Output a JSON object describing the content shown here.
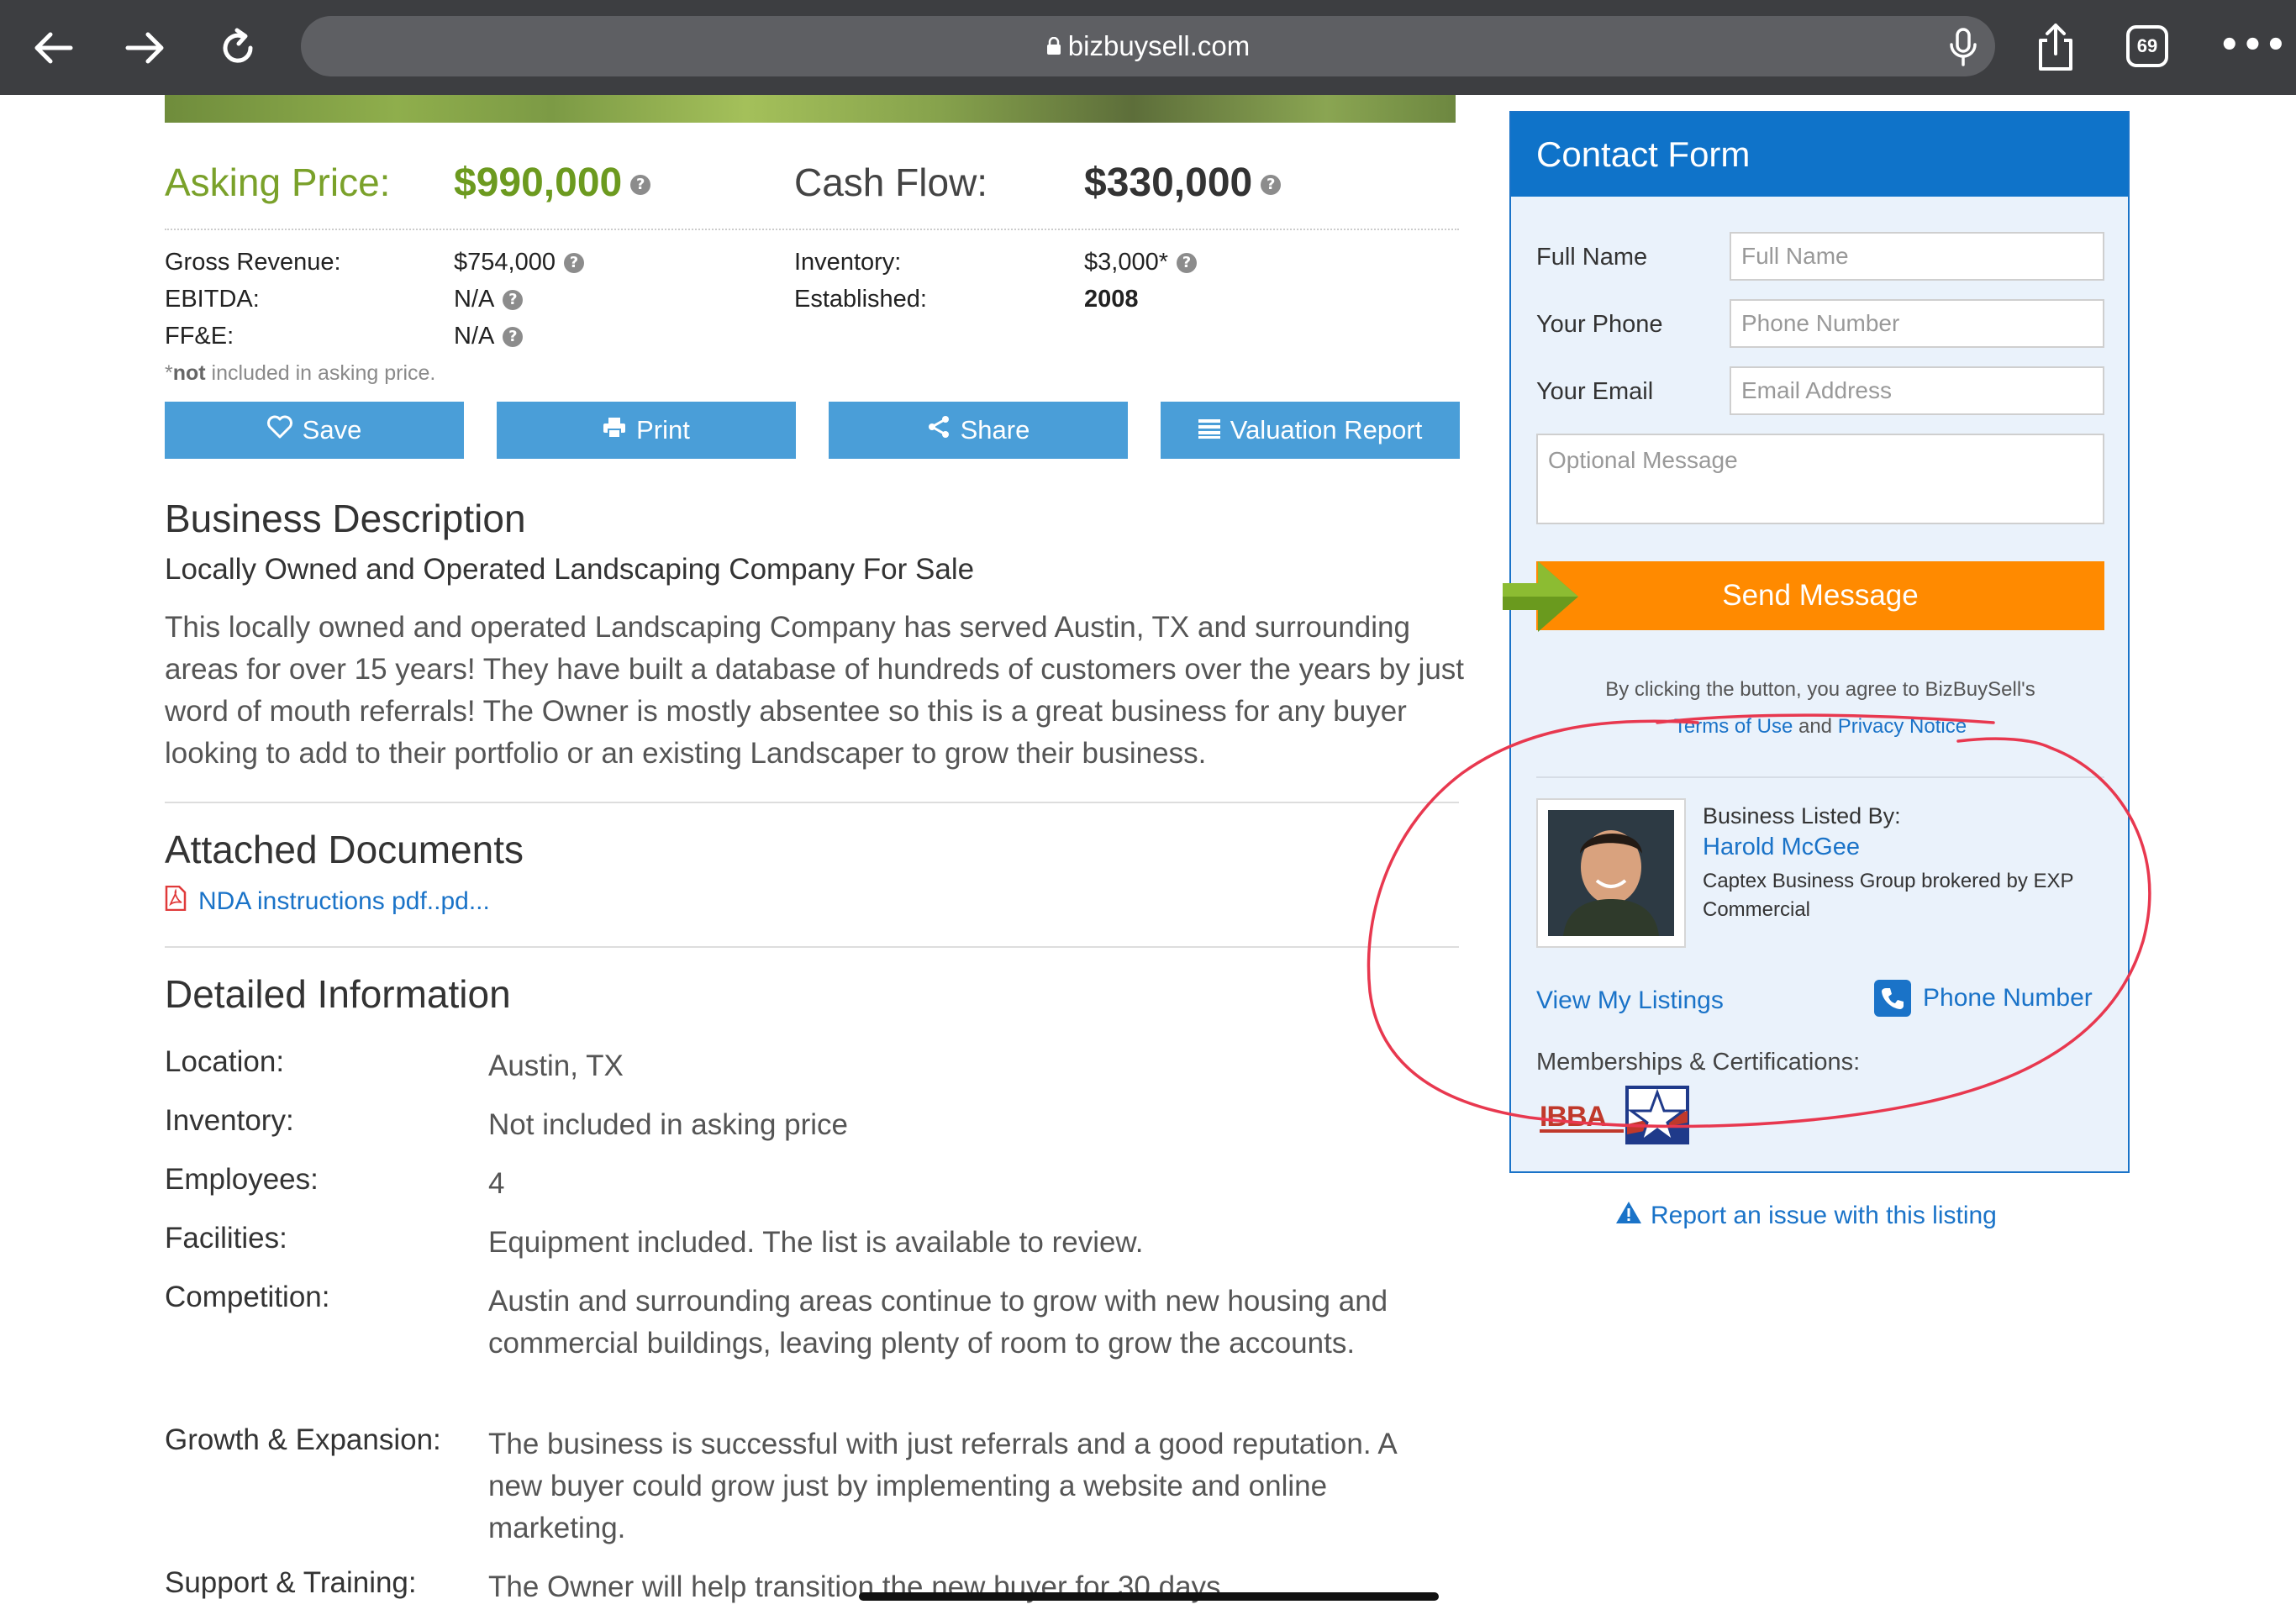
{
  "browser": {
    "url": "bizbuysell.com",
    "tab_count": "69",
    "icons": [
      "back-arrow-icon",
      "forward-arrow-icon",
      "reload-icon",
      "lock-icon",
      "mic-icon",
      "share-icon",
      "tabs-icon",
      "more-icon"
    ]
  },
  "pricing": {
    "asking_label": "Asking Price:",
    "asking_value": "$990,000",
    "cash_label": "Cash Flow:",
    "cash_value": "$330,000"
  },
  "financials": {
    "gross_label": "Gross Revenue:",
    "gross_value": "$754,000",
    "ebitda_label": "EBITDA:",
    "ebitda_value": "N/A",
    "ffe_label": "FF&E:",
    "ffe_value": "N/A",
    "inventory_label": "Inventory:",
    "inventory_value": "$3,000*",
    "established_label": "Established:",
    "established_value": "2008",
    "note_star": "*",
    "note_bold": "not",
    "note_rest": " included in asking price."
  },
  "actions": {
    "save": "Save",
    "print": "Print",
    "share": "Share",
    "valuation": "Valuation Report"
  },
  "description": {
    "heading": "Business Description",
    "subheading": "Locally Owned and Operated Landscaping Company For Sale",
    "body": "This locally owned and operated Landscaping Company has served Austin, TX and surrounding areas for over 15 years! They have built a database of hundreds of customers over the years by just word of mouth referrals! The Owner is mostly absentee so this is a great business for any buyer looking to add to their portfolio or an existing Landscaper to grow their business."
  },
  "documents": {
    "heading": "Attached Documents",
    "file": "NDA instructions pdf..pd..."
  },
  "details": {
    "heading": "Detailed Information",
    "rows": [
      {
        "label": "Location:",
        "value": "Austin, TX"
      },
      {
        "label": "Inventory:",
        "value": "Not included in asking price"
      },
      {
        "label": "Employees:",
        "value": "4"
      },
      {
        "label": "Facilities:",
        "value": "Equipment included. The list is available to review."
      },
      {
        "label": "Competition:",
        "value": "Austin and surrounding areas continue to grow with new housing and commercial buildings, leaving plenty of room to grow the accounts."
      },
      {
        "label": "Growth & Expansion:",
        "value": "The business is successful with just referrals and a good reputation. A new buyer could grow just by implementing a website and online marketing."
      },
      {
        "label": "Support & Training:",
        "value": "The Owner will help transition the new buyer for 30 days."
      }
    ]
  },
  "contact_form": {
    "title": "Contact Form",
    "name_label": "Full Name",
    "name_placeholder": "Full Name",
    "phone_label": "Your Phone",
    "phone_placeholder": "Phone Number",
    "email_label": "Your Email",
    "email_placeholder": "Email Address",
    "message_placeholder": "Optional Message",
    "send": "Send Message",
    "agree_text": "By clicking the button, you agree to BizBuySell's",
    "terms": "Terms of Use",
    "and": " and ",
    "privacy": "Privacy Notice",
    "listed_by": "Business Listed By:",
    "broker_name": "Harold McGee",
    "company": "Captex Business Group brokered by EXP Commercial",
    "view_listings": "View My Listings",
    "phone_number": "Phone Number",
    "memberships": "Memberships & Certifications:",
    "ibba": "IBBA"
  },
  "report": "Report an issue with this listing",
  "colors": {
    "chrome": "#3d3e41",
    "asking_green": "#6c9a1f",
    "button_blue": "#4a9ed8",
    "form_blue": "#0f73c9",
    "send_orange": "#ff8a00",
    "link_blue": "#1a73c8",
    "annotation_red": "#e8384f"
  }
}
